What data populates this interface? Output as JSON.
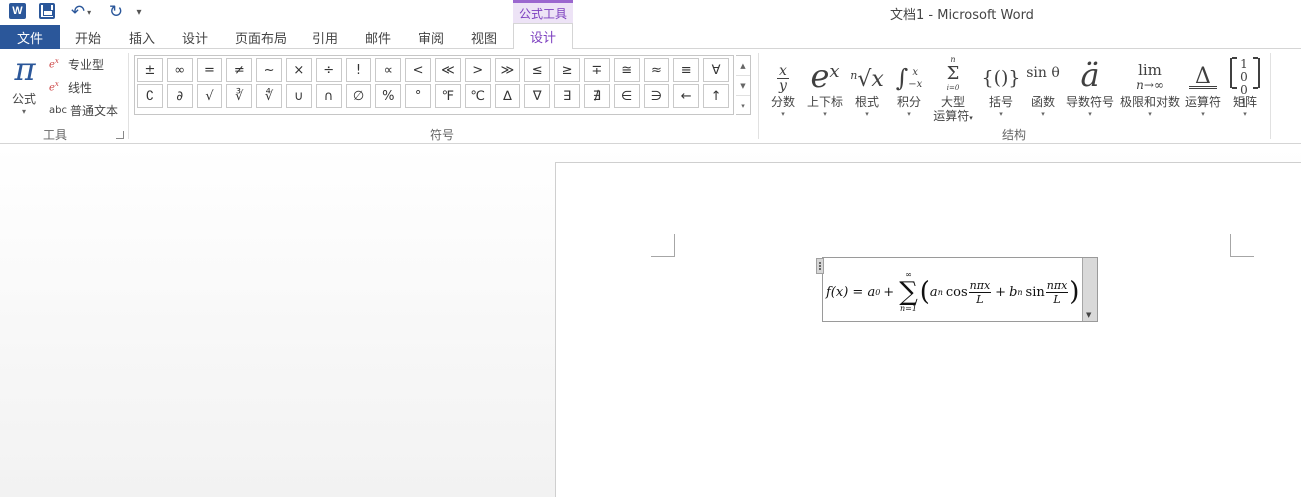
{
  "titlebar": {
    "app_logo": "W",
    "contextual_tab_label": "公式工具",
    "window_title": "文档1 - Microsoft Word",
    "icons": [
      "word-logo",
      "save-icon",
      "undo-icon",
      "redo-icon",
      "customize-qat-icon"
    ]
  },
  "tabs": {
    "file": "文件",
    "items": [
      "开始",
      "插入",
      "设计",
      "页面布局",
      "引用",
      "邮件",
      "审阅",
      "视图"
    ],
    "active": "设计"
  },
  "tools_group": {
    "equation_button": "公式",
    "equation_symbol": "π",
    "professional": "专业型",
    "linear": "线性",
    "plain_text_prefix": "abc",
    "plain_text": "普通文本",
    "group_label": "工具"
  },
  "symbols_group": {
    "row1": [
      "±",
      "∞",
      "=",
      "≠",
      "~",
      "×",
      "÷",
      "!",
      "∝",
      "<",
      "≪",
      ">",
      "≫",
      "≤",
      "≥",
      "∓",
      "≅",
      "≈",
      "≡",
      "∀"
    ],
    "row2": [
      "∁",
      "∂",
      "√",
      "∛",
      "∜",
      "∪",
      "∩",
      "∅",
      "%",
      "°",
      "℉",
      "℃",
      "∆",
      "∇",
      "∃",
      "∄",
      "∈",
      "∋",
      "←",
      "↑"
    ],
    "group_label": "符号"
  },
  "structures_group": {
    "items": [
      {
        "label": "分数"
      },
      {
        "label": "上下标"
      },
      {
        "label": "根式"
      },
      {
        "label": "积分"
      },
      {
        "label": "大型",
        "label2": "运算符"
      },
      {
        "label": "括号"
      },
      {
        "label": "函数"
      },
      {
        "label": "导数符号"
      },
      {
        "label": "极限和对数"
      },
      {
        "label": "运算符"
      },
      {
        "label": "矩阵"
      }
    ],
    "icon_text": {
      "fraction_num": "x",
      "fraction_den": "y",
      "script_base": "e",
      "script_sup": "x",
      "radical_index": "n",
      "radical_body": "√x",
      "integral_sign": "∫",
      "integral_upper": "x",
      "integral_lower": "−x",
      "large_op_upper": "n",
      "large_op_sign": "Σ",
      "large_op_lower": "i=0",
      "bracket": "{()}",
      "function": "sin θ",
      "accent": "ä",
      "limit_top": "lim",
      "limit_bottom": "n→∞",
      "operator": "Δ",
      "matrix": "[10 01]"
    },
    "group_label": "结构"
  },
  "document": {
    "equation": {
      "lhs": "f(x) = a",
      "lhs_sub": "0",
      "plus": "+",
      "sum_upper": "∞",
      "sum_sign": "∑",
      "sum_lower": "n=1",
      "open_paren": "(",
      "a_term": "a",
      "a_sub": "n",
      "cos": "cos",
      "frac_num": "nπx",
      "frac_den": "L",
      "plus2": "+",
      "b_term": "b",
      "b_sub": "n",
      "sin": "sin",
      "close_paren": ")"
    }
  }
}
